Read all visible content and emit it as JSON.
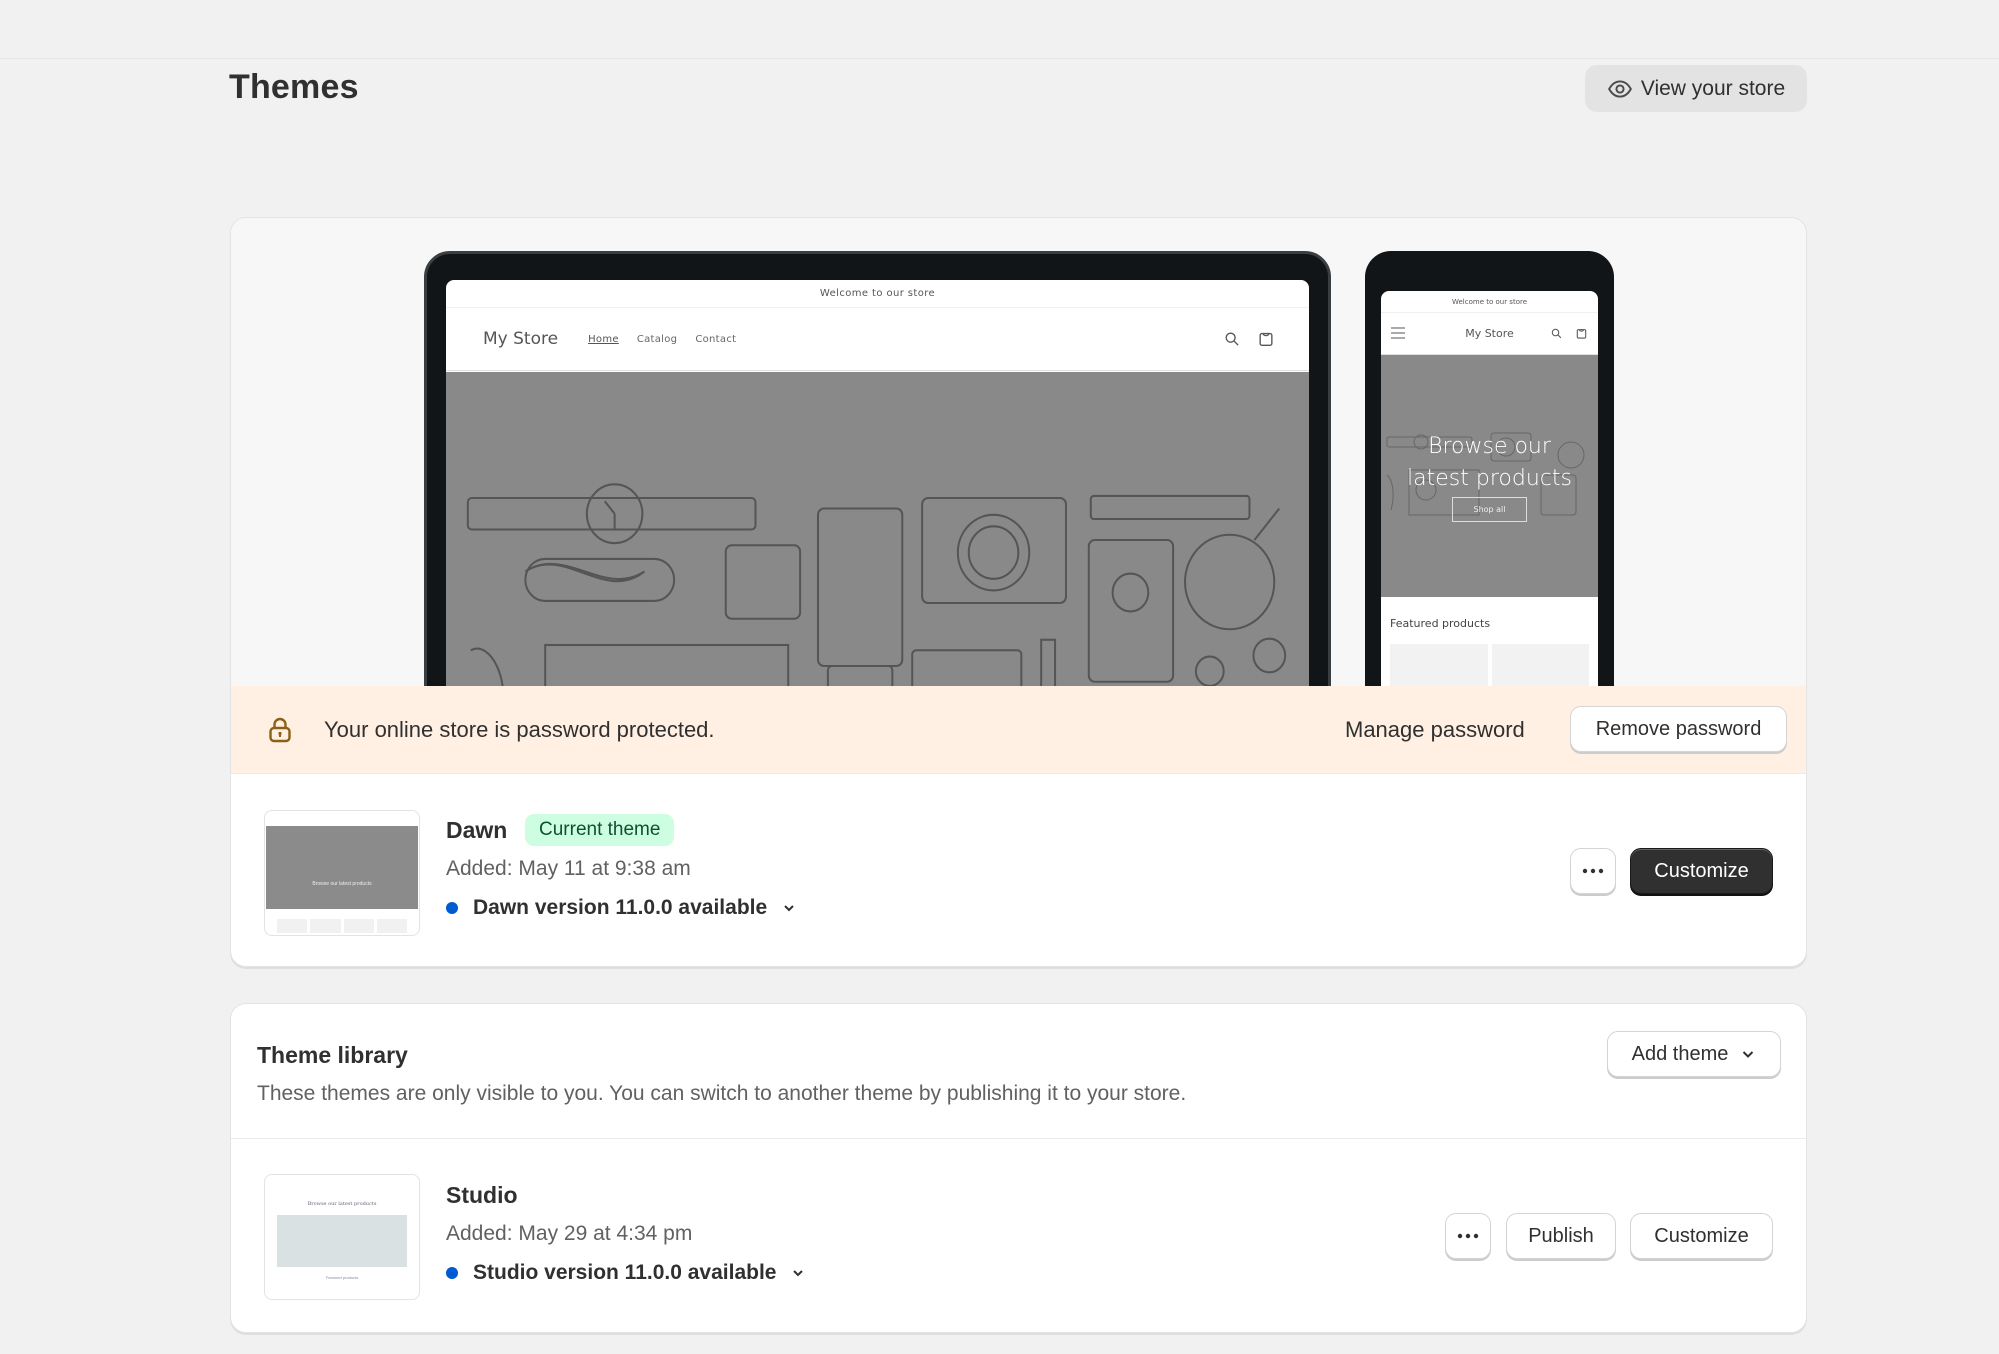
{
  "page": {
    "title": "Themes",
    "view_store_label": "View your store"
  },
  "preview": {
    "announcement": "Welcome to our store",
    "store_name": "My Store",
    "nav": [
      "Home",
      "Catalog",
      "Contact"
    ],
    "hero_title_line1": "Browse our",
    "hero_title_line2": "latest products",
    "shop_all": "Shop all",
    "featured_heading": "Featured products"
  },
  "password_banner": {
    "message": "Your online store is password protected.",
    "manage_label": "Manage password",
    "remove_label": "Remove password"
  },
  "current_theme": {
    "name": "Dawn",
    "badge": "Current theme",
    "added": "Added: May 11 at 9:38 am",
    "version_notice": "Dawn version 11.0.0 available",
    "thumb_text": "Browse our latest products",
    "customize_label": "Customize",
    "more_actions": "More actions"
  },
  "library": {
    "title": "Theme library",
    "description": "These themes are only visible to you. You can switch to another theme by publishing it to your store.",
    "add_theme_label": "Add theme",
    "themes": [
      {
        "name": "Studio",
        "added": "Added: May 29 at 4:34 pm",
        "version_notice": "Studio version 11.0.0 available",
        "thumb_title": "Browse our latest products",
        "thumb_featured": "Featured products",
        "publish_label": "Publish",
        "customize_label": "Customize"
      }
    ]
  },
  "colors": {
    "update_dot": "#005bd3",
    "badge_bg": "#cdfee1",
    "badge_text": "#0c5132",
    "banner_bg": "#fff0e3",
    "lock_icon": "#8a6116",
    "primary_button": "#303030"
  }
}
